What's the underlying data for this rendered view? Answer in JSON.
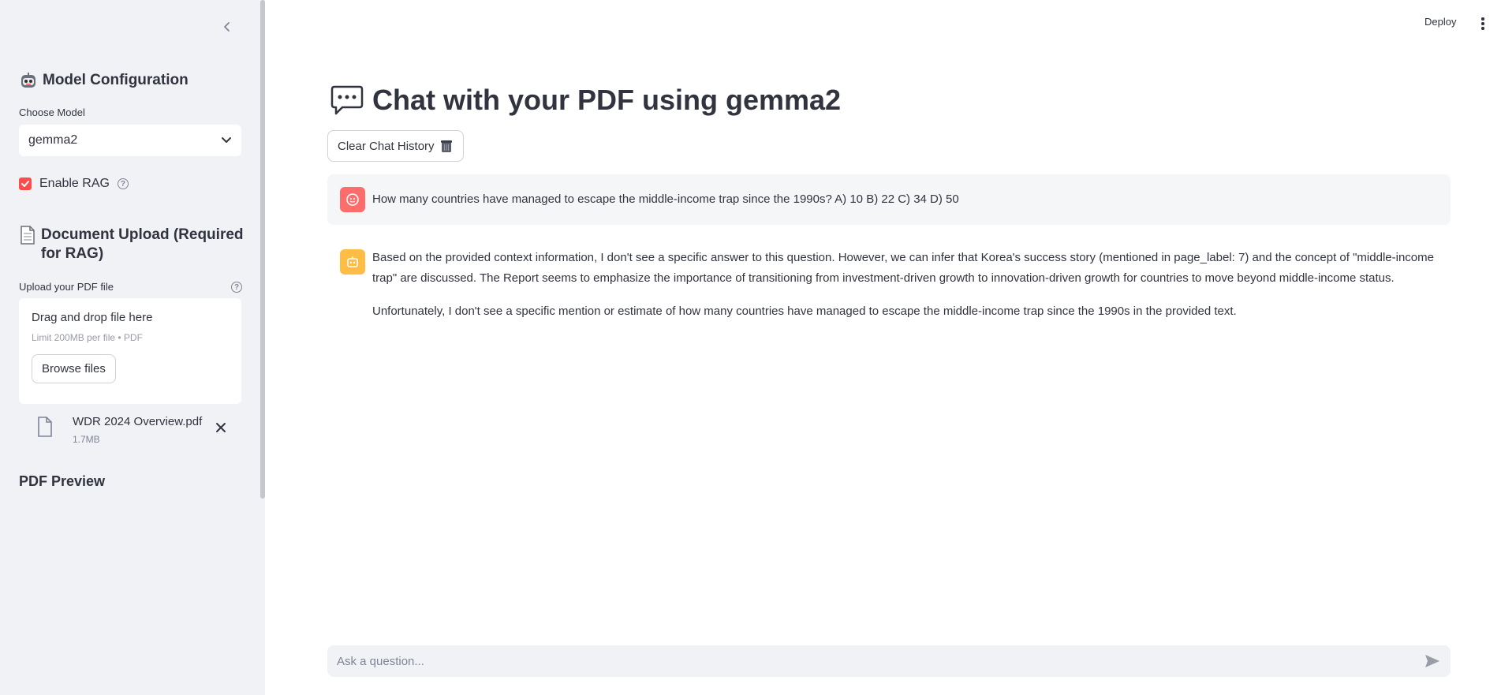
{
  "header": {
    "deploy_label": "Deploy",
    "menu_icon": "more-vertical-icon"
  },
  "sidebar": {
    "collapse_icon": "chevron-left-icon",
    "model_config": {
      "icon": "robot-face-emoji",
      "title": "Model Configuration",
      "choose_label": "Choose Model",
      "selected_model": "gemma2"
    },
    "rag": {
      "label": "Enable RAG",
      "checked": true
    },
    "upload": {
      "icon": "page-emoji",
      "title": "Document Upload (Required for RAG)",
      "label": "Upload your PDF file",
      "dropzone_title": "Drag and drop file here",
      "dropzone_limit": "Limit 200MB per file • PDF",
      "browse_label": "Browse files",
      "file": {
        "name": "WDR 2024 Overview.pdf",
        "size": "1.7MB"
      }
    },
    "preview_title": "PDF Preview"
  },
  "main": {
    "title_icon": "speech-balloon-emoji",
    "title": "Chat with your PDF using gemma2",
    "clear_label": "Clear Chat History",
    "clear_icon": "wastebasket-emoji",
    "messages": [
      {
        "role": "user",
        "text": "How many countries have managed to escape the middle-income trap since the 1990s? A) 10 B) 22 C) 34 D) 50"
      },
      {
        "role": "assistant",
        "paragraphs": [
          "Based on the provided context information, I don't see a specific answer to this question. However, we can infer that Korea's success story (mentioned in page_label: 7) and the concept of \"middle-income",
          "trap\" are discussed. The Report seems to emphasize the importance of transitioning from investment-driven growth to innovation-driven growth for countries to move beyond middle-income status.",
          "Unfortunately, I don't see a specific mention or estimate of how many countries have managed to escape the middle-income trap since the 1990s in the provided text."
        ]
      }
    ],
    "input_placeholder": "Ask a question..."
  },
  "colors": {
    "accent": "#ff4b4b",
    "user_avatar": "#ff6c6c",
    "assistant_avatar": "#ffbd45",
    "sidebar_bg": "#f0f2f6"
  }
}
